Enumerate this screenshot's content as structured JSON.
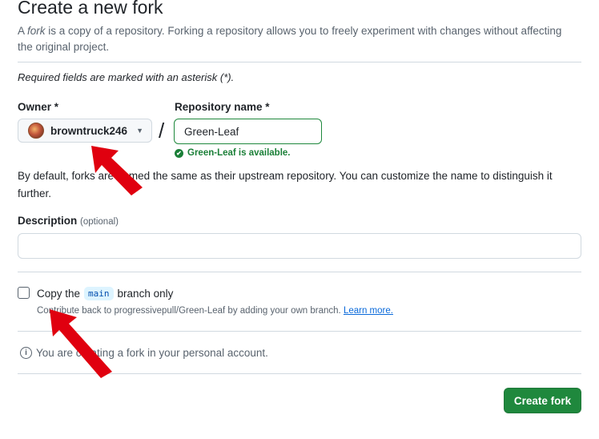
{
  "header": {
    "title": "Create a new fork",
    "intro_prefix": "A ",
    "intro_em": "fork",
    "intro_rest": " is a copy of a repository. Forking a repository allows you to freely experiment with changes without affecting the original project."
  },
  "form": {
    "required_note": "Required fields are marked with an asterisk (*).",
    "owner_label": "Owner *",
    "owner_value": "browntruck246",
    "slash": "/",
    "repo_label": "Repository name *",
    "repo_value": "Green-Leaf",
    "availability": "Green-Leaf is available.",
    "default_note": "By default, forks are named the same as their upstream repository. You can customize the name to distinguish it further.",
    "description_label": "Description",
    "description_optional": "(optional)",
    "description_value": ""
  },
  "copy_branch": {
    "label_before": "Copy the",
    "branch": "main",
    "label_after": "branch only",
    "checked": false,
    "hint": "Contribute back to progressivepull/Green-Leaf by adding your own branch.",
    "learn_more": "Learn more."
  },
  "info": {
    "text": "You are creating a fork in your personal account."
  },
  "actions": {
    "create_label": "Create fork"
  },
  "colors": {
    "primary_green": "#1f883d",
    "success_text": "#1a7f37",
    "link": "#0969da",
    "annotation_arrow": "#e0000f"
  },
  "icons": [
    "owner-avatar",
    "chevron-down-icon",
    "check-circle-icon",
    "info-icon",
    "annotation-arrow"
  ]
}
